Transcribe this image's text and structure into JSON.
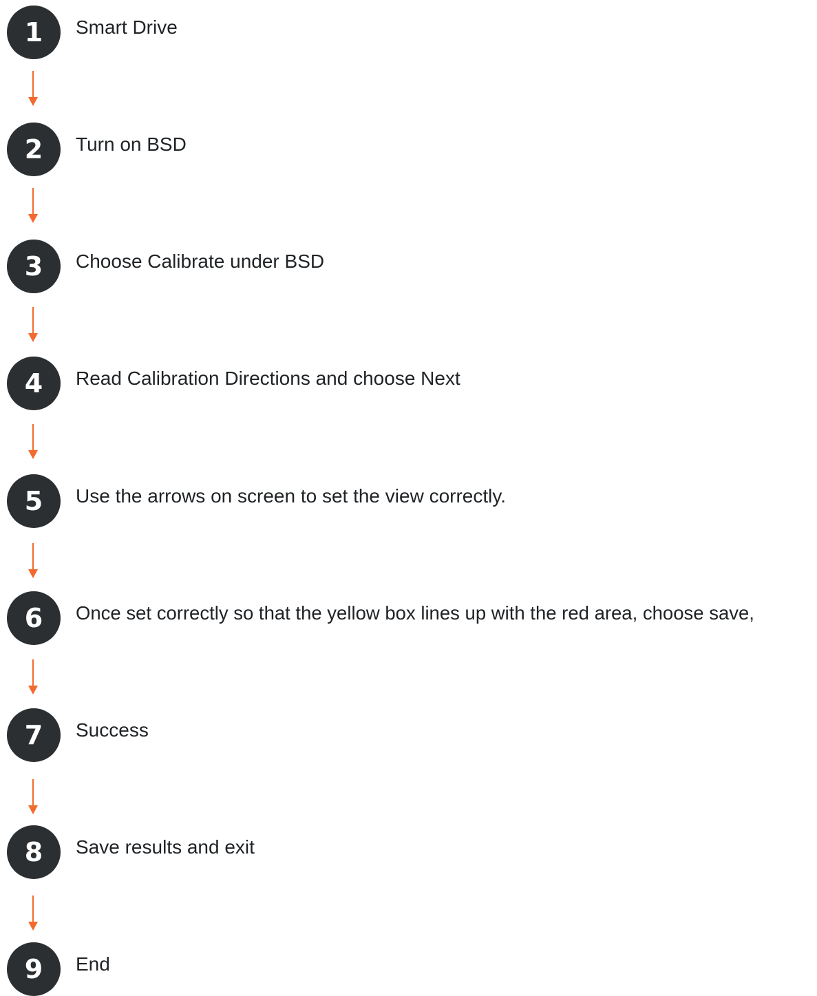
{
  "flowchart": {
    "steps": [
      {
        "number": "1",
        "label": "Smart Drive"
      },
      {
        "number": "2",
        "label": "Turn on BSD"
      },
      {
        "number": "3",
        "label": "Choose Calibrate under BSD"
      },
      {
        "number": "4",
        "label": "Read Calibration Directions and choose Next"
      },
      {
        "number": "5",
        "label": "Use the arrows on screen to set the view correctly."
      },
      {
        "number": "6",
        "label": "Once set correctly so that the yellow box lines up with the red area, choose save,"
      },
      {
        "number": "7",
        "label": "Success"
      },
      {
        "number": "8",
        "label": "Save results and exit"
      },
      {
        "number": "9",
        "label": "End"
      }
    ]
  },
  "colors": {
    "circle": "#2b2f31",
    "arrow": "#f26a2e",
    "text": "#1f2326"
  }
}
